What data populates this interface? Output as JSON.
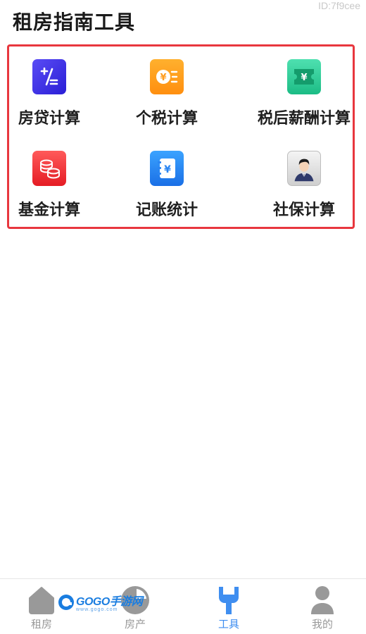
{
  "watermark_id": "ID:7f9cee",
  "page": {
    "title": "租房指南工具"
  },
  "tools": [
    {
      "label": "房贷计算",
      "icon": "plus-minus-icon",
      "color": "#3b2fe8"
    },
    {
      "label": "个税计算",
      "icon": "yuan-coin-list-icon",
      "color": "#ff9d1f"
    },
    {
      "label": "税后薪酬计算",
      "icon": "yuan-ticket-icon",
      "color": "#2ccc96"
    },
    {
      "label": "基金计算",
      "icon": "coin-stack-icon",
      "color": "#ef2b32"
    },
    {
      "label": "记账统计",
      "icon": "yuan-notebook-icon",
      "color": "#2a85f2"
    },
    {
      "label": "社保计算",
      "icon": "person-avatar-icon",
      "color": "#e0e0e0"
    }
  ],
  "highlight_border_color": "#e8373e",
  "bottom_nav": {
    "items": [
      {
        "label": "租房",
        "icon": "house-icon",
        "active": false
      },
      {
        "label": "房产",
        "icon": "pie-chart-icon",
        "active": false
      },
      {
        "label": "工具",
        "icon": "wrench-icon",
        "active": true
      },
      {
        "label": "我的",
        "icon": "user-icon",
        "active": false
      }
    ],
    "active_color": "#3f8ef0",
    "inactive_color": "#999999"
  },
  "overlay_logo": {
    "text": "GOGO手游网",
    "sub": "www.gogo.com"
  }
}
